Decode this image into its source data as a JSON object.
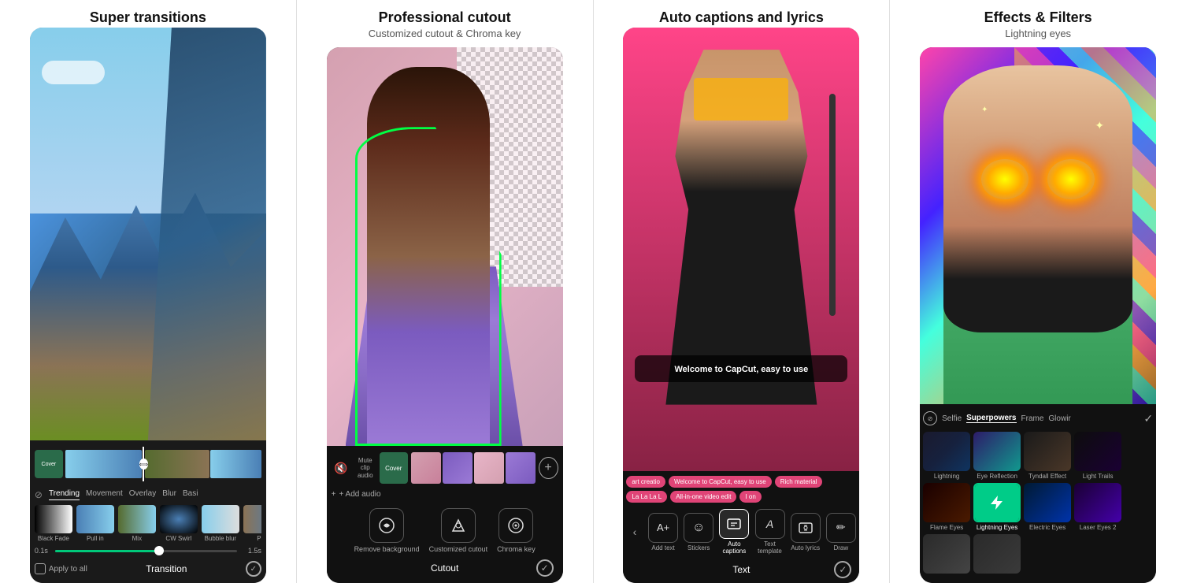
{
  "panels": [
    {
      "id": "panel1",
      "title": "Super transitions",
      "subtitle": "",
      "filterTabs": [
        "Trending",
        "Movement",
        "Overlay",
        "Blur",
        "Basi"
      ],
      "filterItems": [
        {
          "label": "Black Fade"
        },
        {
          "label": "Pull in"
        },
        {
          "label": "Mix"
        },
        {
          "label": "CW Swirl"
        },
        {
          "label": "Bubble blur"
        },
        {
          "label": "Pull"
        }
      ],
      "sliderMin": "0.1s",
      "sliderMax": "1.5s",
      "applyText": "Apply to all",
      "bottomLabel": "Transition",
      "checkLabel": "✓"
    },
    {
      "id": "panel2",
      "title": "Professional cutout",
      "subtitle": "Customized cutout & Chroma key",
      "tools": [
        {
          "label": "Remove\nbackground"
        },
        {
          "label": "Customized\ncutout"
        },
        {
          "label": "Chroma key"
        }
      ],
      "addAudioLabel": "+ Add audio",
      "bottomLabel": "Cutout",
      "checkLabel": "✓"
    },
    {
      "id": "panel3",
      "title": "Auto captions and lyrics",
      "subtitle": "",
      "captionText": "Welcome to CapCut, easy to use",
      "pills": [
        {
          "label": "art creatio",
          "type": "pink"
        },
        {
          "label": "Welcome to CapCut, easy to use",
          "type": "pink"
        },
        {
          "label": "Rich material",
          "type": "pink"
        },
        {
          "label": "La La La L",
          "type": "pink"
        },
        {
          "label": "All-in-one video edit",
          "type": "pink"
        },
        {
          "label": "I on",
          "type": "pink"
        }
      ],
      "tools": [
        {
          "label": "Add text",
          "icon": "A+"
        },
        {
          "label": "Stickers",
          "icon": "☺"
        },
        {
          "label": "Auto\ncaptions",
          "icon": "A+"
        },
        {
          "label": "Text\ntemplate",
          "icon": "A"
        },
        {
          "label": "Auto lyrics",
          "icon": "♪"
        },
        {
          "label": "Draw",
          "icon": "✏"
        }
      ],
      "bottomLabel": "Text",
      "checkLabel": "✓"
    },
    {
      "id": "panel4",
      "title": "Effects & Filters",
      "subtitle": "Lightning eyes",
      "filterTabs": [
        "Selfie",
        "Superpowers",
        "Frame",
        "Glowir"
      ],
      "activeTab": "Superpowers",
      "effects": [
        {
          "label": "Lightning",
          "thumb": "lightning"
        },
        {
          "label": "Eye Reflection",
          "thumb": "eye-ref"
        },
        {
          "label": "Tyndall Effect",
          "thumb": "tyndall"
        },
        {
          "label": "Light Trails",
          "thumb": "light-trails"
        },
        {
          "label": "Flame Eyes",
          "thumb": "flame-eyes"
        },
        {
          "label": "Lightning Eyes",
          "thumb": "lightning-eyes",
          "active": true
        },
        {
          "label": "Electric Eyes",
          "thumb": "electric"
        },
        {
          "label": "Laser Eyes 2",
          "thumb": "laser"
        }
      ]
    }
  ]
}
